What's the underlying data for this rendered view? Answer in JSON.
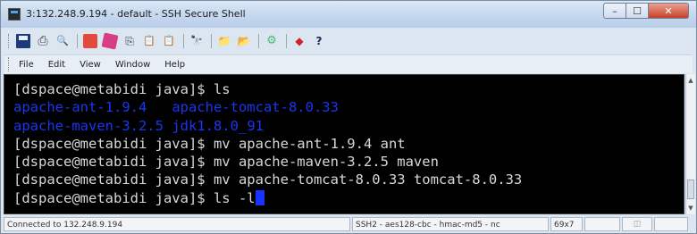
{
  "window": {
    "title": "3:132.248.9.194 - default - SSH Secure Shell",
    "buttons": {
      "minimize": "–",
      "maximize": "☐",
      "close": "✕"
    }
  },
  "toolbar": {
    "icons": [
      "save-icon",
      "print-icon",
      "print-preview-icon",
      "color-icon",
      "color-palette-icon",
      "copy-icon",
      "paste-icon",
      "paste-special-icon",
      "find-icon",
      "new-connection-icon",
      "profiles-icon",
      "settings-icon",
      "file-transfer-icon",
      "help-icon"
    ]
  },
  "menu": {
    "items": [
      "File",
      "Edit",
      "View",
      "Window",
      "Help"
    ]
  },
  "terminal": {
    "prompt": "[dspace@metabidi java]$",
    "lines": [
      {
        "prompt": "[dspace@metabidi java]$",
        "command": " ls"
      },
      {
        "col1": "apache-ant-1.9.4",
        "col2": "apache-tomcat-8.0.33"
      },
      {
        "col1": "apache-maven-3.2.5",
        "col2": "jdk1.8.0_91"
      },
      {
        "prompt": "[dspace@metabidi java]$",
        "command": " mv apache-ant-1.9.4 ant"
      },
      {
        "prompt": "[dspace@metabidi java]$",
        "command": " mv apache-maven-3.2.5 maven"
      },
      {
        "prompt": "[dspace@metabidi java]$",
        "command": " mv apache-tomcat-8.0.33 tomcat-8.0.33"
      },
      {
        "prompt": "[dspace@metabidi java]$",
        "command": " ls -l"
      }
    ],
    "colors": {
      "background": "#000000",
      "text": "#d8d8d8",
      "directory": "#1a36f0",
      "cursor": "#1733ff"
    }
  },
  "status": {
    "connection": "Connected to 132.248.9.194",
    "cipher": "SSH2 - aes128-cbc - hmac-md5 - nc",
    "size": "69x7"
  }
}
